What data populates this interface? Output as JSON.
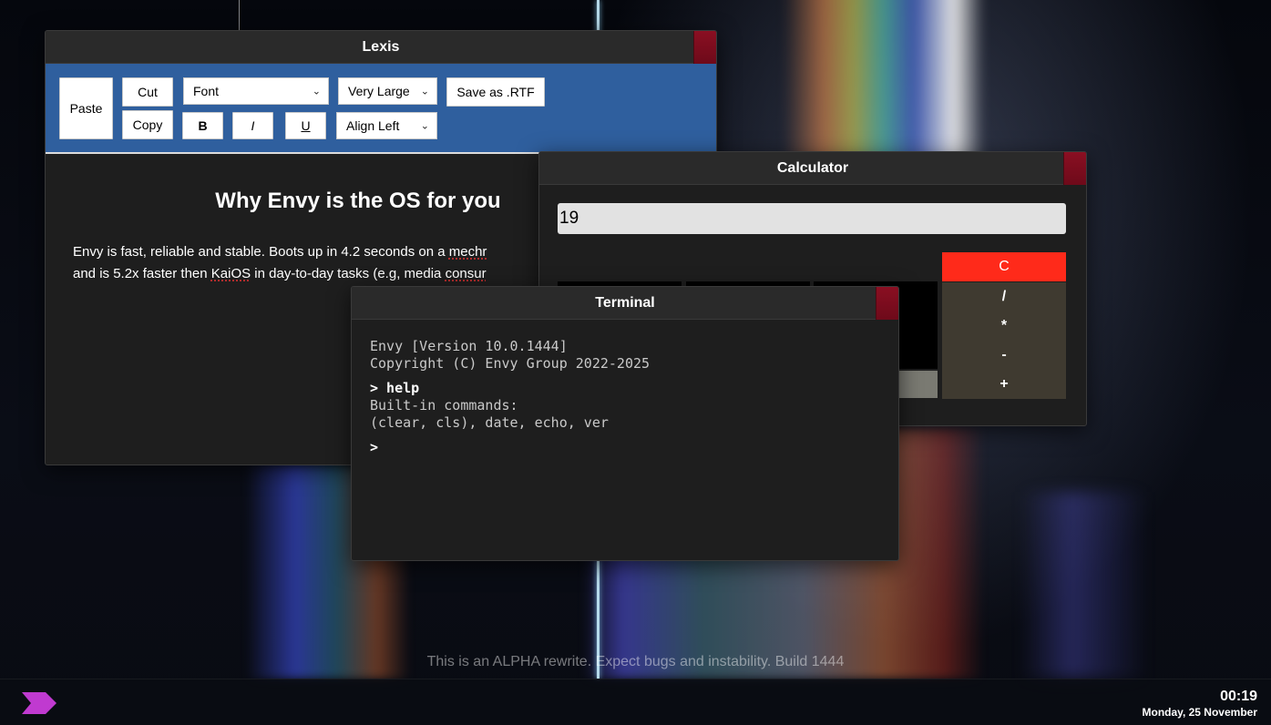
{
  "lexis": {
    "title": "Lexis",
    "toolbar": {
      "paste": "Paste",
      "cut": "Cut",
      "copy": "Copy",
      "font_select": "Font",
      "size_select": "Very Large",
      "save": "Save as .RTF",
      "bold": "B",
      "italic": "I",
      "underline": "U",
      "align_select": "Align Left"
    },
    "document": {
      "heading": "Why Envy is the OS for you",
      "p1_a": "Envy is fast, reliable and stable. Boots up in 4.2 seconds on a ",
      "p1_b": "mechr",
      "p2_a": "and is 5.2x faster then ",
      "p2_b": "KaiOS",
      "p2_c": " in day-to-day tasks (e.g, media ",
      "p2_d": "consur"
    }
  },
  "calculator": {
    "title": "Calculator",
    "display": "19",
    "keys": {
      "clear": "C",
      "divide": "/",
      "multiply": "*",
      "subtract": "-",
      "add": "+"
    }
  },
  "terminal": {
    "title": "Terminal",
    "lines": {
      "version": "Envy [Version 10.0.1444]",
      "copyright": "Copyright (C) Envy Group 2022-2025",
      "cmd1": "> help",
      "out1": "Built-in commands:",
      "out2": "(clear, cls), date, echo, ver",
      "prompt": ">"
    }
  },
  "desktop": {
    "alpha_notice": "This is an ALPHA rewrite. Expect bugs and instability. Build 1444"
  },
  "taskbar": {
    "time": "00:19",
    "date": "Monday, 25 November",
    "start_icon": "chevron-logo-icon",
    "accent": "#c03ad0"
  },
  "colors": {
    "lexis_toolbar": "#2f5f9e",
    "close_button": "#8a0f22",
    "calc_clear": "#ff2a1a",
    "calc_operator": "#3f3a30"
  }
}
